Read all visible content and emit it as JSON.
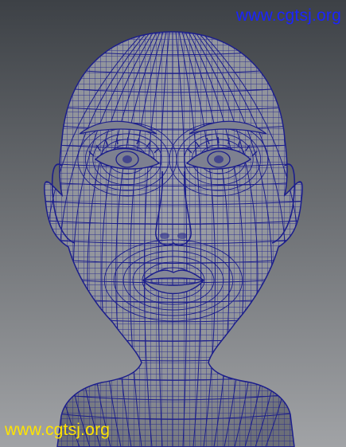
{
  "viewport": {
    "background_top": "#3d4146",
    "background_bottom": "#a1a3a6"
  },
  "model": {
    "description_icon": "wireframe-head-mesh",
    "surface_color": "#8f9299",
    "wire_color": "#1c1e8c"
  },
  "watermarks": {
    "top_text": "www.cgtsj.org",
    "top_color": "#1a24ff",
    "bottom_text": "www.cgtsj.org",
    "bottom_color": "#ffe400"
  }
}
